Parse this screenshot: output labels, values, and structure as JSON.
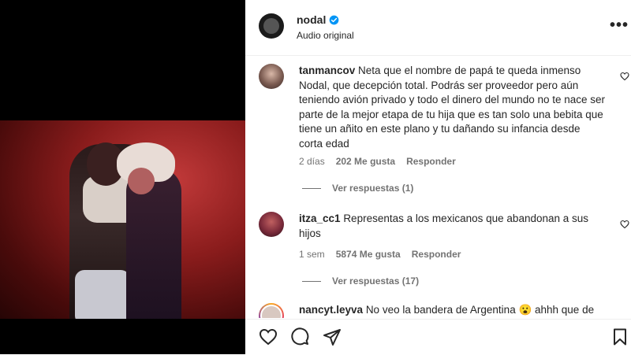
{
  "post": {
    "username": "nodal",
    "audio": "Audio original",
    "more_icon": "•••"
  },
  "comments": [
    {
      "username": "tanmancov",
      "text": "Neta que el nombre de papá te queda inmenso Nodal, que decepción total. Podrás ser proveedor pero aún teniendo avión privado y todo el dinero del mundo no te nace ser parte de la mejor etapa de tu hija que es tan solo una bebita que tiene un añito en este plano y tu dañando su infancia desde corta edad",
      "time": "2 días",
      "likes": "202 Me gusta",
      "reply": "Responder",
      "view_replies": "Ver respuestas (1)"
    },
    {
      "username": "itza_cc1",
      "text": "Representas a los mexicanos que abandonan a sus hijos",
      "time": "1 sem",
      "likes": "5874 Me gusta",
      "reply": "Responder",
      "view_replies": "Ver respuestas (17)"
    },
    {
      "username": "nancyt.leyva",
      "text": "No veo la bandera de Argentina 😮 ahhh que de"
    }
  ],
  "colors": {
    "verified": "#0095f6",
    "text": "#262626",
    "muted": "#737373"
  }
}
